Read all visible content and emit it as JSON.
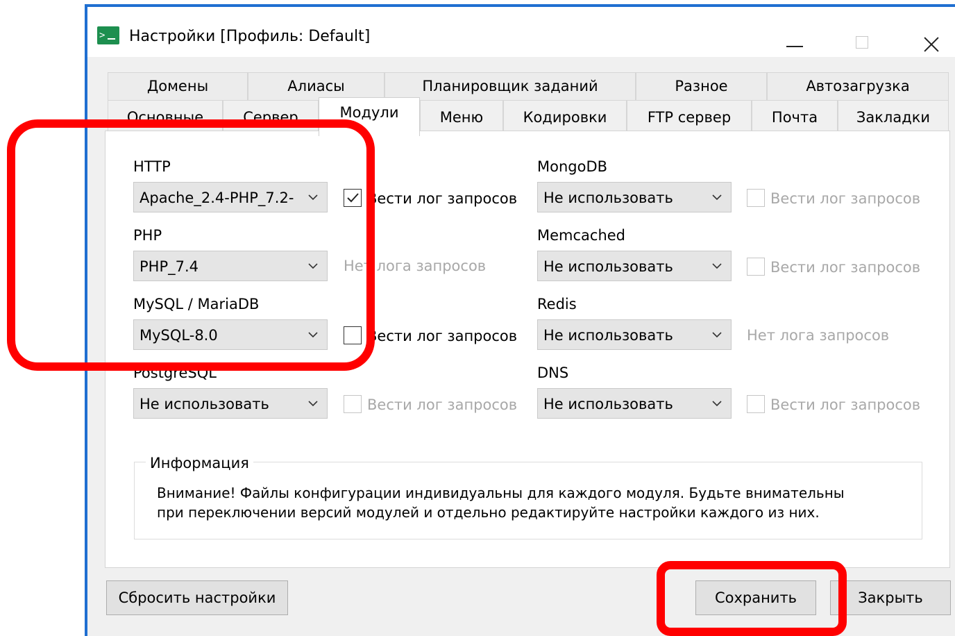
{
  "window": {
    "title": "Настройки [Профиль: Default]"
  },
  "tabs": {
    "row1": [
      "Домены",
      "Алиасы",
      "Планировщик заданий",
      "Разное",
      "Автозагрузка"
    ],
    "row2": [
      "Основные",
      "Сервер",
      "Модули",
      "Меню",
      "Кодировки",
      "FTP сервер",
      "Почта",
      "Закладки"
    ],
    "active": "Модули"
  },
  "modules": {
    "http": {
      "label": "HTTP",
      "value": "Apache_2.4-PHP_7.2-",
      "log": "Вести лог запросов",
      "log_checked": true
    },
    "php": {
      "label": "PHP",
      "value": "PHP_7.4",
      "log": "Нет лога запросов"
    },
    "mysql": {
      "label": "MySQL / MariaDB",
      "value": "MySQL-8.0",
      "log": "Вести лог запросов",
      "log_checked": false
    },
    "postgresql": {
      "label": "PostgreSQL",
      "value": "Не использовать",
      "log": "Вести лог запросов",
      "log_checked": false,
      "log_disabled": true
    },
    "mongodb": {
      "label": "MongoDB",
      "value": "Не использовать",
      "log": "Вести лог запросов",
      "log_checked": false,
      "log_disabled": true
    },
    "memcached": {
      "label": "Memcached",
      "value": "Не использовать",
      "log": "Вести лог запросов",
      "log_checked": false,
      "log_disabled": true
    },
    "redis": {
      "label": "Redis",
      "value": "Не использовать",
      "log": "Нет лога запросов"
    },
    "dns": {
      "label": "DNS",
      "value": "Не использовать",
      "log": "Вести лог запросов",
      "log_checked": false,
      "log_disabled": true
    }
  },
  "info": {
    "title": "Информация",
    "line1": "Внимание! Файлы конфигурации индивидуальны для каждого модуля. Будьте внимательны",
    "line2": "при переключении версий модулей и отдельно редактируйте настройки каждого из них."
  },
  "buttons": {
    "reset": "Сбросить настройки",
    "save": "Сохранить",
    "close": "Закрыть"
  },
  "colors": {
    "highlight": "#ff0000",
    "window_border": "#1f6fd1"
  }
}
